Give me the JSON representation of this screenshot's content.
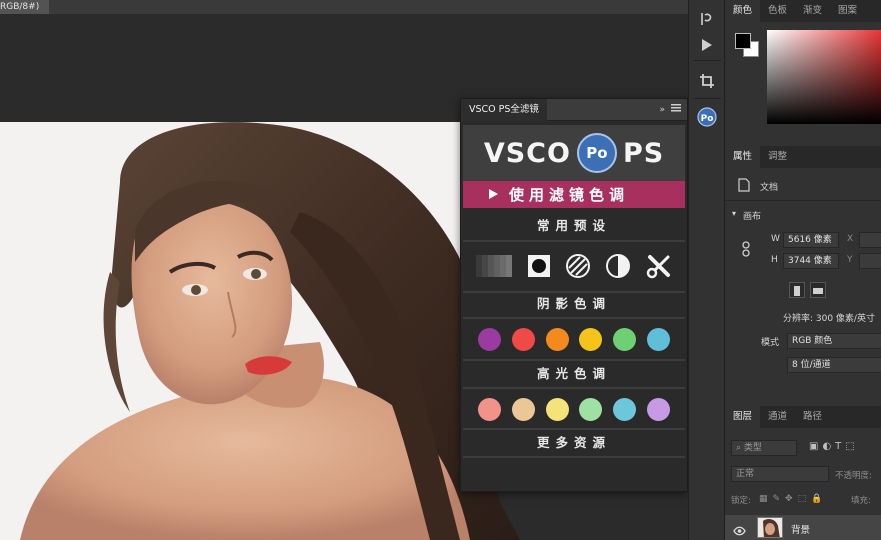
{
  "document": {
    "tab_label": "RGB/8#)"
  },
  "plugin": {
    "title": "VSCO PS全滤镜",
    "expand_label": "»",
    "logo_left": "VSCO",
    "logo_badge": "Po",
    "logo_right": "PS",
    "apply_label": "使用滤镜色调",
    "sections": {
      "presets": "常用预设",
      "shadows": "阴影色调",
      "highlights": "高光色调",
      "more": "更多资源"
    },
    "preset_icons": [
      "gradient-bars-icon",
      "square-vignette-icon",
      "stripe-circle-icon",
      "half-circle-icon",
      "wrench-tools-icon"
    ],
    "shadow_colors": [
      "#9b3aa0",
      "#ef4a45",
      "#f38a1f",
      "#f6c31a",
      "#6fcf73",
      "#5fbfd8"
    ],
    "highlight_colors": [
      "#f2938b",
      "#ebc796",
      "#f4e27a",
      "#9fe0a3",
      "#6cc7dc",
      "#c79ae6"
    ]
  },
  "color_panel": {
    "tabs": [
      "颜色",
      "色板",
      "渐变",
      "图案"
    ]
  },
  "properties_panel": {
    "tabs": [
      "属性",
      "调整"
    ],
    "doc_label": "文档",
    "canvas_label": "画布",
    "w_label": "W",
    "w_value": "5616 像素",
    "x_label": "X",
    "h_label": "H",
    "h_value": "3744 像素",
    "y_label": "Y",
    "resolution": "分辨率: 300 像素/英寸",
    "mode_label": "模式",
    "mode_value": "RGB 颜色",
    "depth_value": "8 位/通道"
  },
  "layers_panel": {
    "tabs": [
      "图层",
      "通道",
      "路径"
    ],
    "filter_placeholder": "类型",
    "blend_mode": "正常",
    "opacity_label": "不透明度:",
    "lock_label": "锁定:",
    "fill_label": "填充:",
    "layer_name": "背景"
  },
  "colors": {
    "accent_bar": "#a8305e",
    "badge_blue": "#3d6fb6"
  }
}
